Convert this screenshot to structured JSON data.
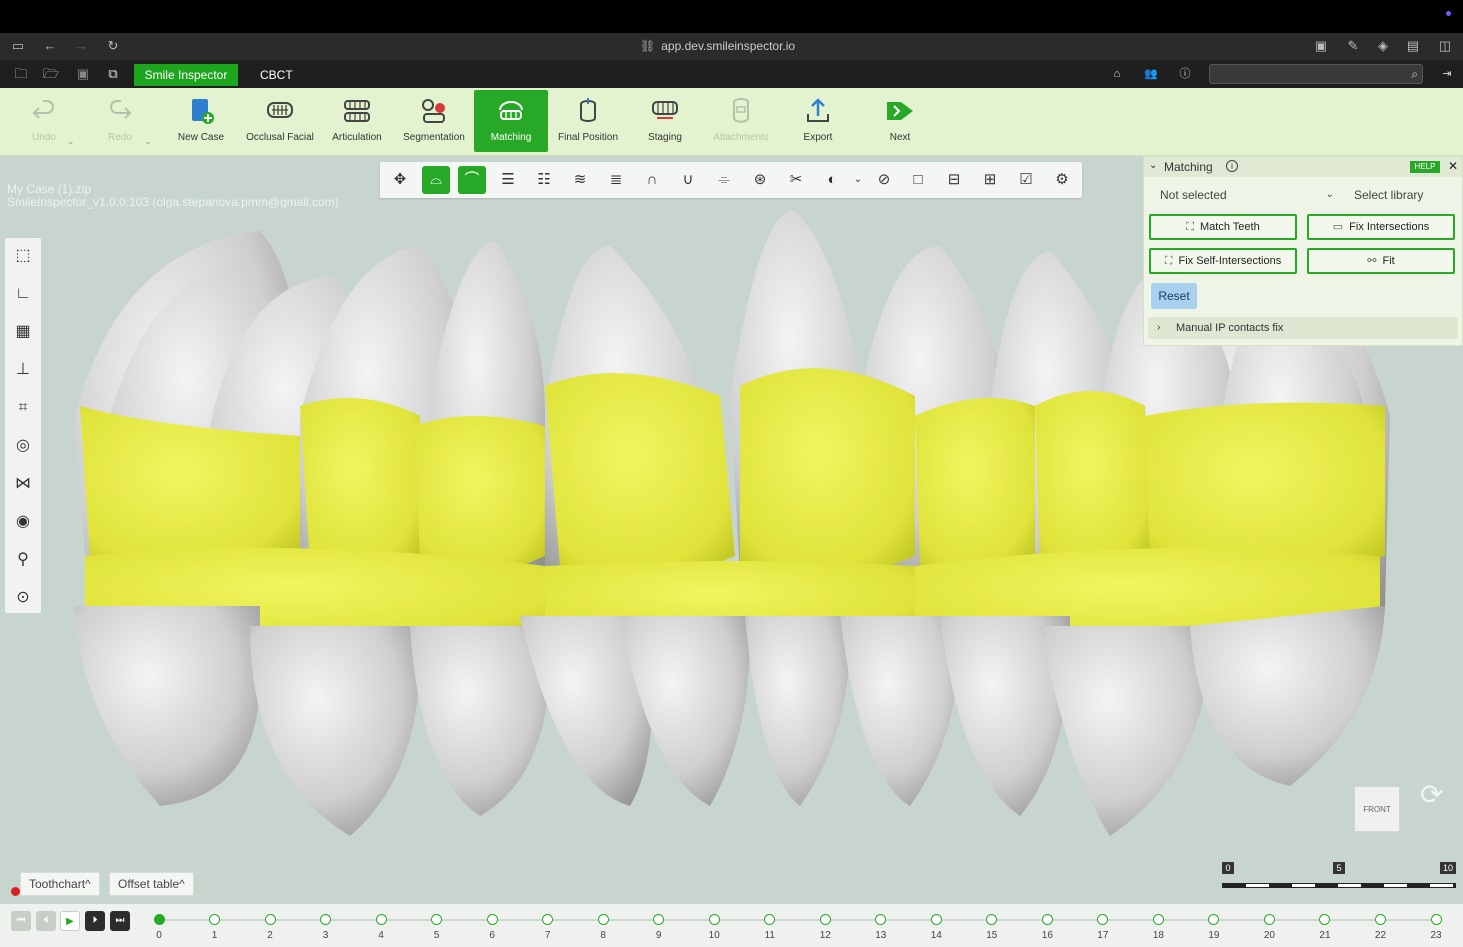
{
  "browser": {
    "url": "app.dev.smileinspector.io"
  },
  "appbar": {
    "tab_active": "Smile Inspector",
    "tab_other": "CBCT",
    "search_value": ""
  },
  "toolbar": {
    "items": [
      {
        "label": "Undo",
        "state": "disabled"
      },
      {
        "label": "Redo",
        "state": "disabled"
      },
      {
        "label": "New Case",
        "state": "normal"
      },
      {
        "label": "Occlusal Facial",
        "state": "normal"
      },
      {
        "label": "Articulation",
        "state": "normal"
      },
      {
        "label": "Segmentation",
        "state": "normal"
      },
      {
        "label": "Matching",
        "state": "active"
      },
      {
        "label": "Final Position",
        "state": "normal"
      },
      {
        "label": "Staging",
        "state": "normal"
      },
      {
        "label": "Attachments",
        "state": "disabled"
      },
      {
        "label": "Export",
        "state": "normal"
      },
      {
        "label": "Next",
        "state": "normal"
      }
    ]
  },
  "case": {
    "file": "My Case (1).zip",
    "version": "SmileInspector_v1.0.0.103 (olga.stepanova.pmm@gmail.com)"
  },
  "matching_panel": {
    "title": "Matching",
    "help": "HELP",
    "select_value": "Not selected",
    "select_library": "Select library",
    "match_teeth": "Match Teeth",
    "fix_intersections": "Fix Intersections",
    "fix_self_intersections": "Fix Self-Intersections",
    "fit": "Fit",
    "reset": "Reset",
    "manual_ip": "Manual IP contacts fix"
  },
  "view_cube": {
    "label": "FRONT"
  },
  "bottom": {
    "toothchart": "Toothchart",
    "offset_table": "Offset table"
  },
  "scale": {
    "labels": [
      "0",
      "5",
      "10"
    ]
  },
  "timeline": {
    "current_step": 0,
    "steps": [
      "0",
      "1",
      "2",
      "3",
      "4",
      "5",
      "6",
      "7",
      "8",
      "9",
      "10",
      "11",
      "12",
      "13",
      "14",
      "15",
      "16",
      "17",
      "18",
      "19",
      "20",
      "21",
      "22",
      "23"
    ]
  },
  "colors": {
    "accent": "#27a827",
    "toolbar_bg": "#e4f3cf",
    "viewport_bg": "#c8d5ce",
    "tooth_yellow": "#e2e838",
    "tooth_gray": "#d6d6d6"
  }
}
